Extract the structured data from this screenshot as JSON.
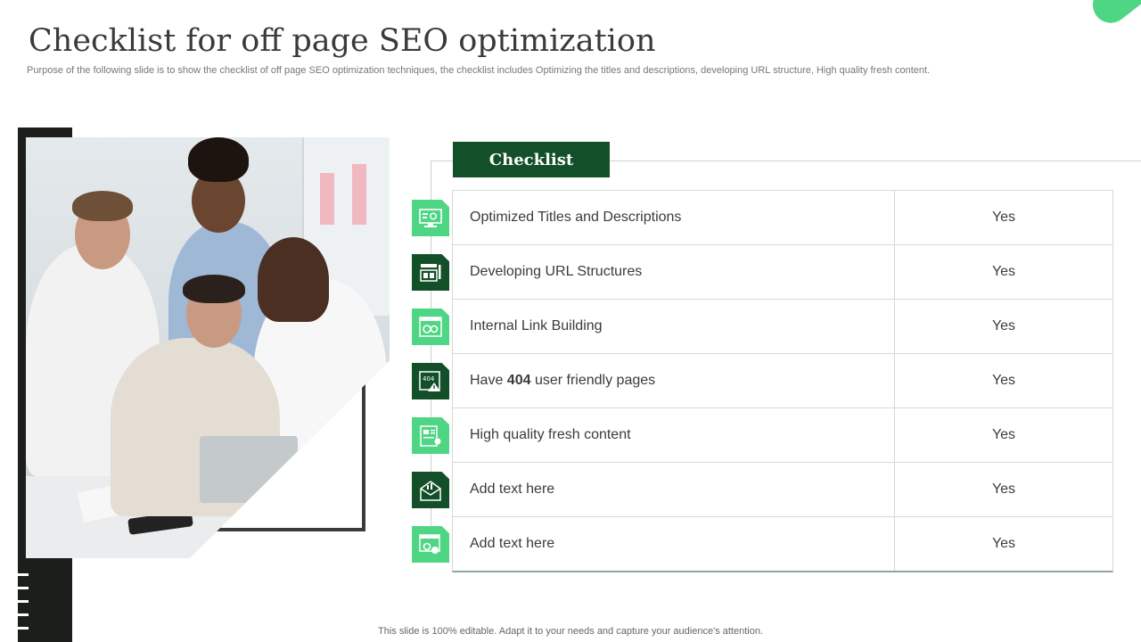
{
  "slide": {
    "title": "Checklist for off page SEO optimization",
    "subtitle": "Purpose of the following slide is to show the checklist of off page SEO  optimization techniques, the checklist includes Optimizing the titles and descriptions, developing URL structure, High quality fresh content.",
    "footer": "This slide is 100% editable. Adapt it to your needs and capture your audience's attention."
  },
  "checklist": {
    "header": "Checklist",
    "rows": [
      {
        "label_pre": "Optimized Titles and Descriptions",
        "label_bold": "",
        "label_post": "",
        "value": "Yes",
        "icon": "monitor-gear-icon",
        "tone": "light"
      },
      {
        "label_pre": "Developing URL Structures",
        "label_bold": "",
        "label_post": "",
        "value": "Yes",
        "icon": "sitemap-pencil-icon",
        "tone": "dark"
      },
      {
        "label_pre": "Internal  Link Building",
        "label_bold": "",
        "label_post": "",
        "value": "Yes",
        "icon": "link-gears-icon",
        "tone": "light"
      },
      {
        "label_pre": "Have ",
        "label_bold": "404",
        "label_post": " user friendly pages",
        "value": "Yes",
        "icon": "error-404-page-icon",
        "tone": "dark"
      },
      {
        "label_pre": "High quality fresh content",
        "label_bold": "",
        "label_post": "",
        "value": "Yes",
        "icon": "content-document-icon",
        "tone": "light"
      },
      {
        "label_pre": "Add text here",
        "label_bold": "",
        "label_post": "",
        "value": "Yes",
        "icon": "envelope-chart-icon",
        "tone": "dark"
      },
      {
        "label_pre": "Add text here",
        "label_bold": "",
        "label_post": "",
        "value": "Yes",
        "icon": "window-gears-icon",
        "tone": "light"
      }
    ]
  },
  "colors": {
    "accent_light": "#4fd684",
    "accent_dark": "#135029",
    "sidebar": "#1b1e1b"
  }
}
